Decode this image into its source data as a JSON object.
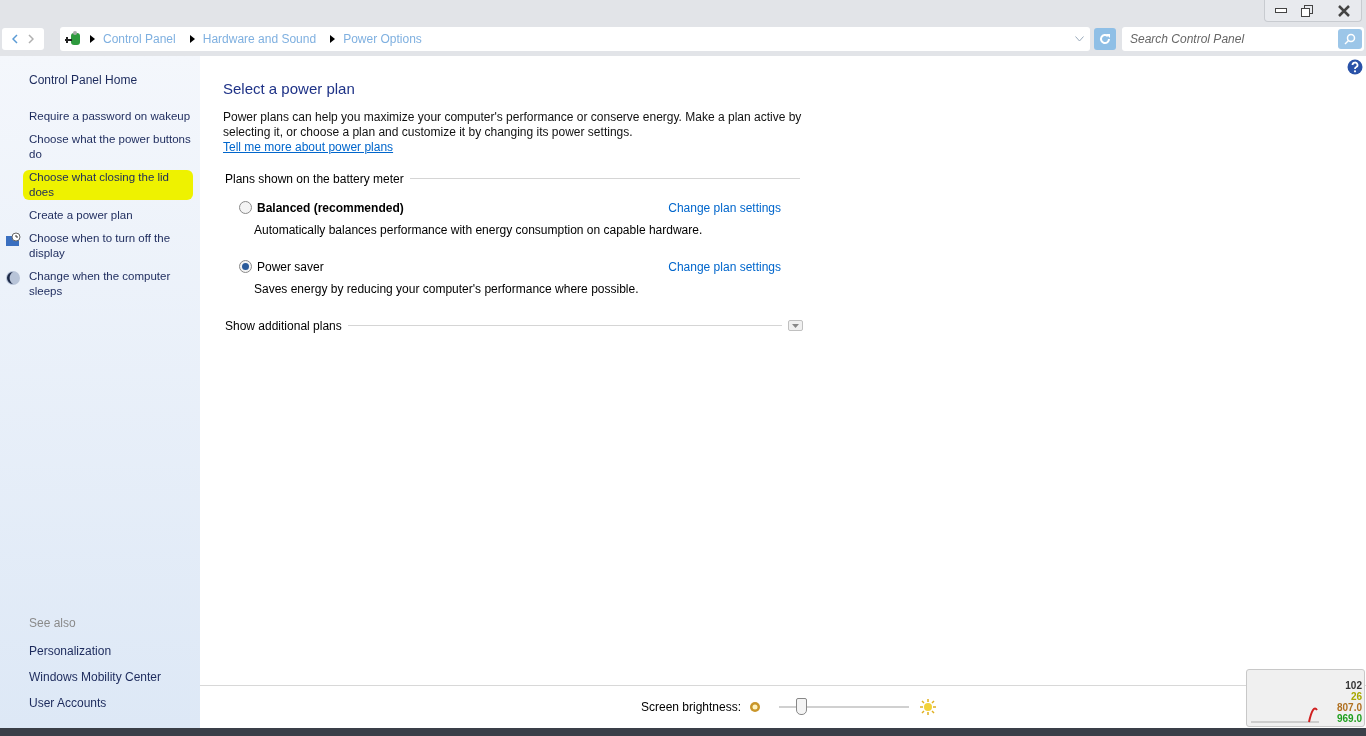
{
  "breadcrumb": [
    "Control Panel",
    "Hardware and Sound",
    "Power Options"
  ],
  "search": {
    "placeholder": "Search Control Panel"
  },
  "sidebar": {
    "home": "Control Panel Home",
    "items": [
      {
        "label": "Require a password on wakeup",
        "kind": "plain",
        "highlighted": false
      },
      {
        "label": "Choose what the power buttons do",
        "kind": "plain",
        "highlighted": false
      },
      {
        "label": "Choose what closing the lid does",
        "kind": "plain",
        "highlighted": true
      },
      {
        "label": "Create a power plan",
        "kind": "plain",
        "highlighted": false
      },
      {
        "label": "Choose when to turn off the display",
        "kind": "display",
        "highlighted": false
      },
      {
        "label": "Change when the computer sleeps",
        "kind": "sleep",
        "highlighted": false
      }
    ],
    "see_also_title": "See also",
    "see_also": [
      "Personalization",
      "Windows Mobility Center",
      "User Accounts"
    ]
  },
  "main": {
    "title": "Select a power plan",
    "intro": "Power plans can help you maximize your computer's performance or conserve energy. Make a plan active by selecting it, or choose a plan and customize it by changing its power settings.",
    "intro_link": "Tell me more about power plans",
    "group_title": "Plans shown on the battery meter",
    "plans": [
      {
        "name": "Balanced (recommended)",
        "description": "Automatically balances performance with energy consumption on capable hardware.",
        "link": "Change plan settings",
        "selected": false
      },
      {
        "name": "Power saver",
        "description": "Saves energy by reducing your computer's performance where possible.",
        "link": "Change plan settings",
        "selected": true
      }
    ],
    "additional": "Show additional plans"
  },
  "brightness": {
    "label": "Screen brightness:",
    "level": 0.14
  },
  "gadget": {
    "readings": [
      {
        "text": "102",
        "color": "#333333"
      },
      {
        "text": "26",
        "color": "#a8a800"
      },
      {
        "text": "807.0",
        "color": "#b07020"
      },
      {
        "text": "969.0",
        "color": "#20a020"
      }
    ]
  }
}
